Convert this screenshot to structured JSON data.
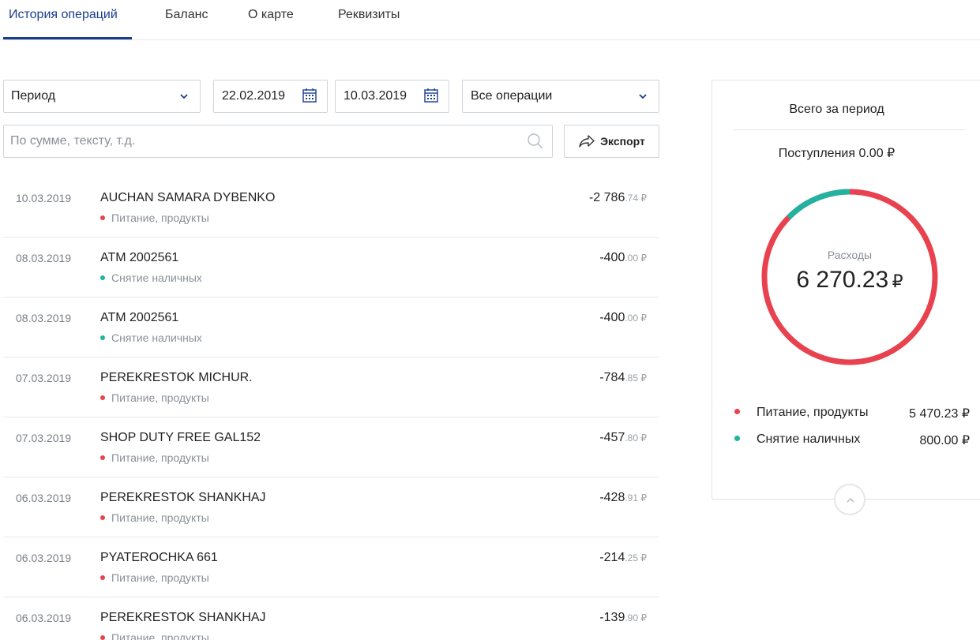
{
  "tabs": [
    {
      "label": "История операций",
      "active": true
    },
    {
      "label": "Баланс"
    },
    {
      "label": "О карте"
    },
    {
      "label": "Реквизиты"
    }
  ],
  "filters": {
    "period_label": "Период",
    "date_from": "22.02.2019",
    "date_to": "10.03.2019",
    "operations_label": "Все операции",
    "search_placeholder": "По сумме, тексту, т.д.",
    "export_label": "Экспорт"
  },
  "operations": [
    {
      "date": "10.03.2019",
      "title": "AUCHAN SAMARA DYBENKO",
      "category": "Питание, продукты",
      "category_color": "#e8424f",
      "amount_int": "-2 786",
      "amount_frac": ".74 ₽"
    },
    {
      "date": "08.03.2019",
      "title": "ATM 2002561",
      "category": "Снятие наличных",
      "category_color": "#22b3a0",
      "amount_int": "-400",
      "amount_frac": ".00 ₽"
    },
    {
      "date": "08.03.2019",
      "title": "ATM 2002561",
      "category": "Снятие наличных",
      "category_color": "#22b3a0",
      "amount_int": "-400",
      "amount_frac": ".00 ₽"
    },
    {
      "date": "07.03.2019",
      "title": "PEREKRESTOK MICHUR.",
      "category": "Питание, продукты",
      "category_color": "#e8424f",
      "amount_int": "-784",
      "amount_frac": ".85 ₽"
    },
    {
      "date": "07.03.2019",
      "title": "SHOP DUTY FREE GAL152",
      "category": "Питание, продукты",
      "category_color": "#e8424f",
      "amount_int": "-457",
      "amount_frac": ".80 ₽"
    },
    {
      "date": "06.03.2019",
      "title": "PEREKRESTOK SHANKHAJ",
      "category": "Питание, продукты",
      "category_color": "#e8424f",
      "amount_int": "-428",
      "amount_frac": ".91 ₽"
    },
    {
      "date": "06.03.2019",
      "title": "PYATEROCHKA 661",
      "category": "Питание, продукты",
      "category_color": "#e8424f",
      "amount_int": "-214",
      "amount_frac": ".25 ₽"
    },
    {
      "date": "06.03.2019",
      "title": "PEREKRESTOK SHANKHAJ",
      "category": "Питание, продукты",
      "category_color": "#e8424f",
      "amount_int": "-139",
      "amount_frac": ".90 ₽"
    }
  ],
  "summary": {
    "title": "Всего за период",
    "income": "Поступления 0.00 ₽",
    "expenses_label": "Расходы",
    "expenses_value": "6 270.23",
    "expenses_currency": "₽",
    "legend": [
      {
        "name": "Питание, продукты",
        "value": "5 470.23 ₽",
        "amount": 5470.23,
        "color": "#e8424f"
      },
      {
        "name": "Снятие наличных",
        "value": "800.00 ₽",
        "amount": 800.0,
        "color": "#22b3a0"
      }
    ]
  },
  "icons": {
    "period_chevron": "chevron-down-icon",
    "date_from_icon": "calendar-icon",
    "date_to_icon": "calendar-icon",
    "operations_chevron": "chevron-down-icon",
    "search": "search-icon",
    "export": "share-arrow-icon",
    "collapse": "chevron-up-icon"
  }
}
